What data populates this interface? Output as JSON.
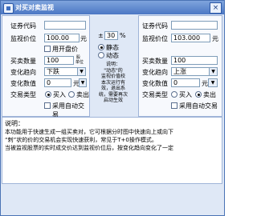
{
  "window": {
    "title": "对买对卖监视",
    "close_label": "×"
  },
  "left": {
    "code_label": "证券代码",
    "code_value": "",
    "monitor_price_label": "监视价位",
    "monitor_price_value": "100.00",
    "unit_yuan": "元",
    "open_price_check_label": "用开盘价",
    "buy_sell_qty_label": "买卖数量",
    "buy_sell_qty_value": "100",
    "qty_unit_top": "股",
    "qty_unit_bottom": "单位",
    "change_trend_label": "变化趋向",
    "change_trend_value": "下跌",
    "change_value_label": "变化数值",
    "change_value_value": "0",
    "change_value_unit": "元",
    "trade_type_label": "交易类型",
    "buy_label": "买入",
    "sell_label": "卖出",
    "auto_trade_label": "采用自动交易"
  },
  "center": {
    "pct_prefix": "±",
    "pct_value": "30",
    "pct_suffix": "%",
    "static_label": "静态",
    "dynamic_label": "动态",
    "note_lines": [
      "说明：",
      "\"动态\"的",
      "监视价值校",
      "本次运行有",
      "效，退出系",
      "统，需要再次",
      "启动生效"
    ]
  },
  "right": {
    "code_label": "证券代码",
    "code_value": "",
    "monitor_price_label": "监视价位",
    "monitor_price_value": "103.000",
    "unit_yuan": "元",
    "buy_sell_qty_label": "买卖数量",
    "buy_sell_qty_value": "100",
    "change_trend_label": "变化趋向",
    "change_trend_value": "上涨",
    "change_value_label": "变化数值",
    "change_value_value": "0",
    "change_value_unit": "元",
    "trade_type_label": "交易类型",
    "buy_label": "买入",
    "sell_label": "卖出",
    "auto_trade_label": "采用自动交易"
  },
  "description": {
    "title": "说明：",
    "line1": "本功能用于快速生成一组买卖对，它可根据分时图中快速向上或向下",
    "line2": "“刺”状的价的交易机会实现快速获利，常见于T+0操作模式。",
    "line3": "当被监视股票的实时成交价达到监视价位后，按变化趋向变化了一定"
  }
}
